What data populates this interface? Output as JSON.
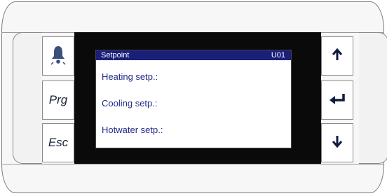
{
  "keys": {
    "alarm_icon": "bell-icon",
    "prg_label": "Prg",
    "esc_label": "Esc",
    "up_icon": "arrow-up-icon",
    "enter_icon": "enter-icon",
    "down_icon": "arrow-down-icon"
  },
  "screen": {
    "title": "Setpoint",
    "code": "U01",
    "rows": [
      "Heating setp.:",
      "Cooling setp.:",
      "Hotwater setp.:"
    ]
  },
  "colors": {
    "header_bg": "#1a1f7a",
    "text": "#222a88",
    "bell": "#3a4f7a"
  }
}
